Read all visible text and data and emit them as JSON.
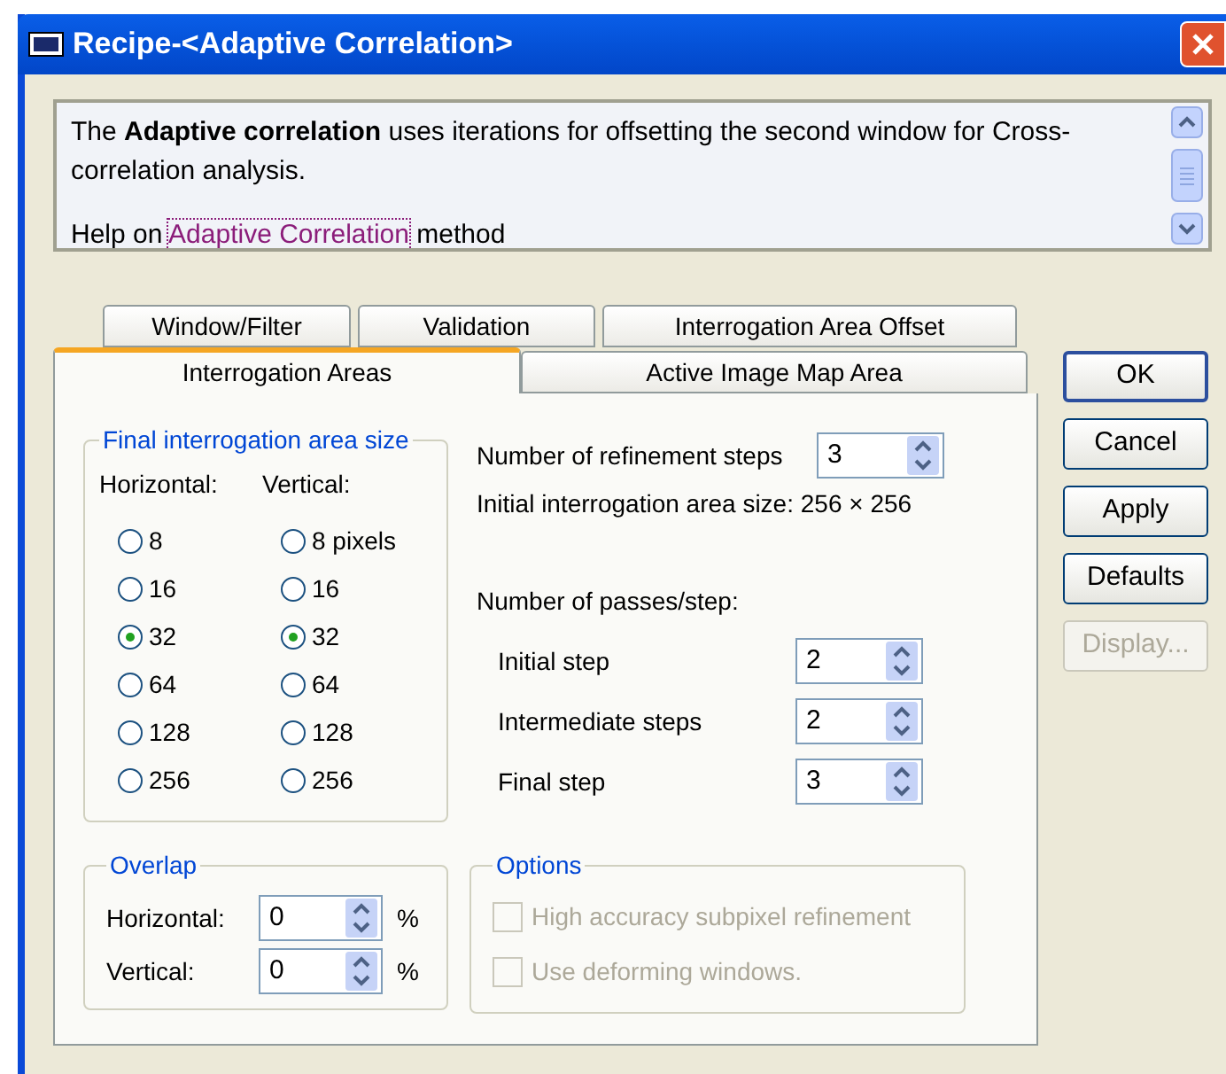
{
  "window": {
    "title": "Recipe-<Adaptive Correlation>"
  },
  "description": {
    "text": "The **Adaptive correlation** uses iterations for offsetting the second window for Cross-correlation analysis.",
    "help_prefix": "Help on",
    "help_link": "Adaptive Correlation",
    "help_suffix": "method"
  },
  "tab_rows": [
    [
      {
        "label": "Window/Filter",
        "selected": false
      },
      {
        "label": "Validation",
        "selected": false
      },
      {
        "label": "Interrogation Area Offset",
        "selected": false
      }
    ],
    [
      {
        "label": "Interrogation Areas",
        "selected": true
      },
      {
        "label": "Active Image Map Area",
        "selected": false
      }
    ]
  ],
  "final_size": {
    "title": "Final interrogation area size",
    "columns": [
      {
        "heading": "Horizontal:",
        "options": [
          {
            "label": "8",
            "selected": false
          },
          {
            "label": "16",
            "selected": false
          },
          {
            "label": "32",
            "selected": true
          },
          {
            "label": "64",
            "selected": false
          },
          {
            "label": "128",
            "selected": false
          },
          {
            "label": "256",
            "selected": false
          }
        ]
      },
      {
        "heading": "Vertical:",
        "options": [
          {
            "label": "8 pixels",
            "selected": false
          },
          {
            "label": "16",
            "selected": false
          },
          {
            "label": "32",
            "selected": true
          },
          {
            "label": "64",
            "selected": false
          },
          {
            "label": "128",
            "selected": false
          },
          {
            "label": "256",
            "selected": false
          }
        ]
      }
    ]
  },
  "refinement": {
    "label": "Number of refinement steps",
    "value": "3",
    "initial_size": "Initial interrogation area size: 256 × 256"
  },
  "passes": {
    "heading": "Number of passes/step:",
    "steps": [
      {
        "label": "Initial step",
        "value": "2"
      },
      {
        "label": "Intermediate steps",
        "value": "2"
      },
      {
        "label": "Final step",
        "value": "3"
      }
    ]
  },
  "overlap": {
    "title": "Overlap",
    "fields": [
      {
        "label": "Horizontal:",
        "value": "0",
        "unit": "%"
      },
      {
        "label": "Vertical:",
        "value": "0",
        "unit": "%"
      }
    ]
  },
  "options": {
    "title": "Options",
    "disabled": true,
    "items": [
      {
        "label": "High accuracy subpixel refinement",
        "checked": false
      },
      {
        "label": "Use deforming windows.",
        "checked": false
      }
    ]
  },
  "buttons": [
    {
      "label": "OK",
      "default": true,
      "disabled": false
    },
    {
      "label": "Cancel",
      "default": false,
      "disabled": false
    },
    {
      "label": "Apply",
      "default": false,
      "disabled": false
    },
    {
      "label": "Defaults",
      "default": false,
      "disabled": false
    },
    {
      "label": "Display...",
      "default": false,
      "disabled": true
    }
  ]
}
